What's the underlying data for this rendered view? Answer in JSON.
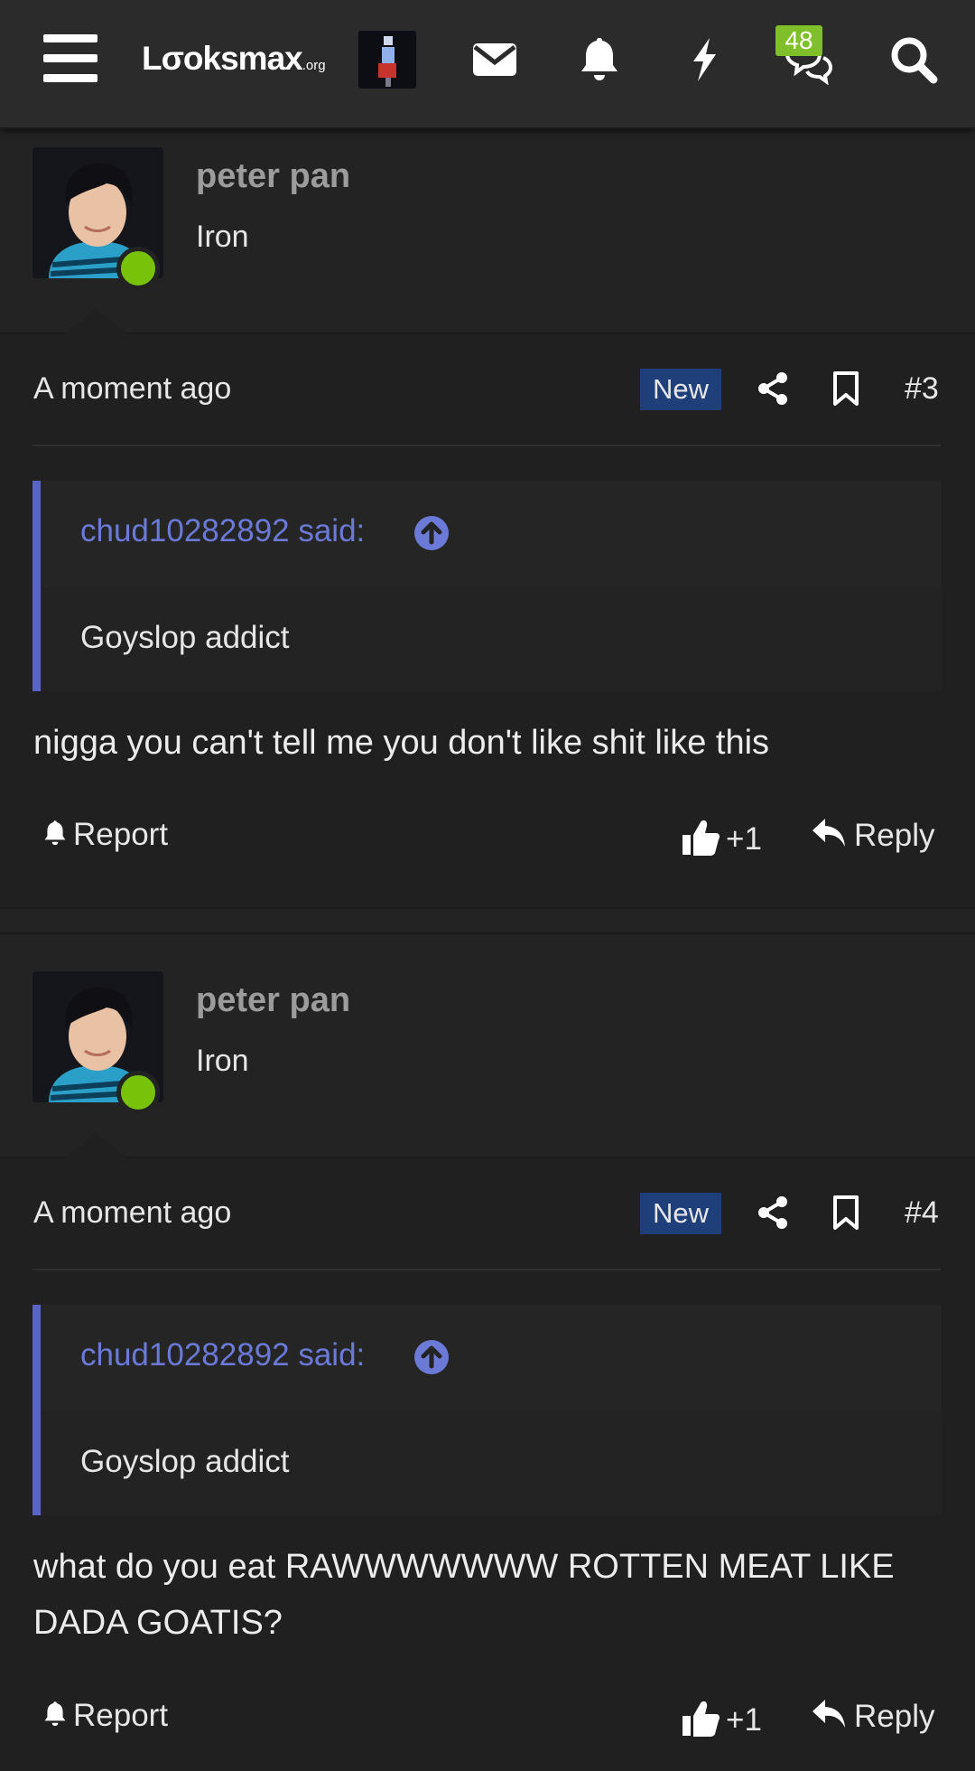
{
  "nav": {
    "logo_text": "Lσoksmax",
    "logo_tld": ".org",
    "conversations_badge": "48"
  },
  "posts": [
    {
      "username": "peter pan",
      "user_title": "Iron",
      "time": "A moment ago",
      "new_label": "New",
      "post_number": "#3",
      "quote_author": "chud10282892 said:",
      "quote_text": "Goyslop addict",
      "message": "nigga you can't tell me you don't like shit like this",
      "report_label": "Report",
      "like_count": "+1",
      "reply_label": "Reply"
    },
    {
      "username": "peter pan",
      "user_title": "Iron",
      "time": "A moment ago",
      "new_label": "New",
      "post_number": "#4",
      "quote_author": "chud10282892 said:",
      "quote_text": "Goyslop addict",
      "message": "what do you eat RAWWWWWWW ROTTEN MEAT LIKE DADA GOATIS?",
      "report_label": "Report",
      "like_count": "+1",
      "reply_label": "Reply"
    }
  ],
  "icons": {
    "nav": [
      "menu-icon",
      "envelope-icon",
      "bell-icon",
      "lightning-icon",
      "conversations-icon",
      "search-icon"
    ],
    "post": [
      "share-icon",
      "bookmark-icon",
      "arrow-up-circle-icon",
      "bell-icon",
      "thumbs-up-icon",
      "reply-icon"
    ]
  },
  "colors": {
    "online": "#78c20a",
    "badge": "#7fbf2a",
    "new_badge": "#1f3f7a",
    "quote_accent": "#5865c4",
    "quote_author": "#6a7ad6"
  }
}
